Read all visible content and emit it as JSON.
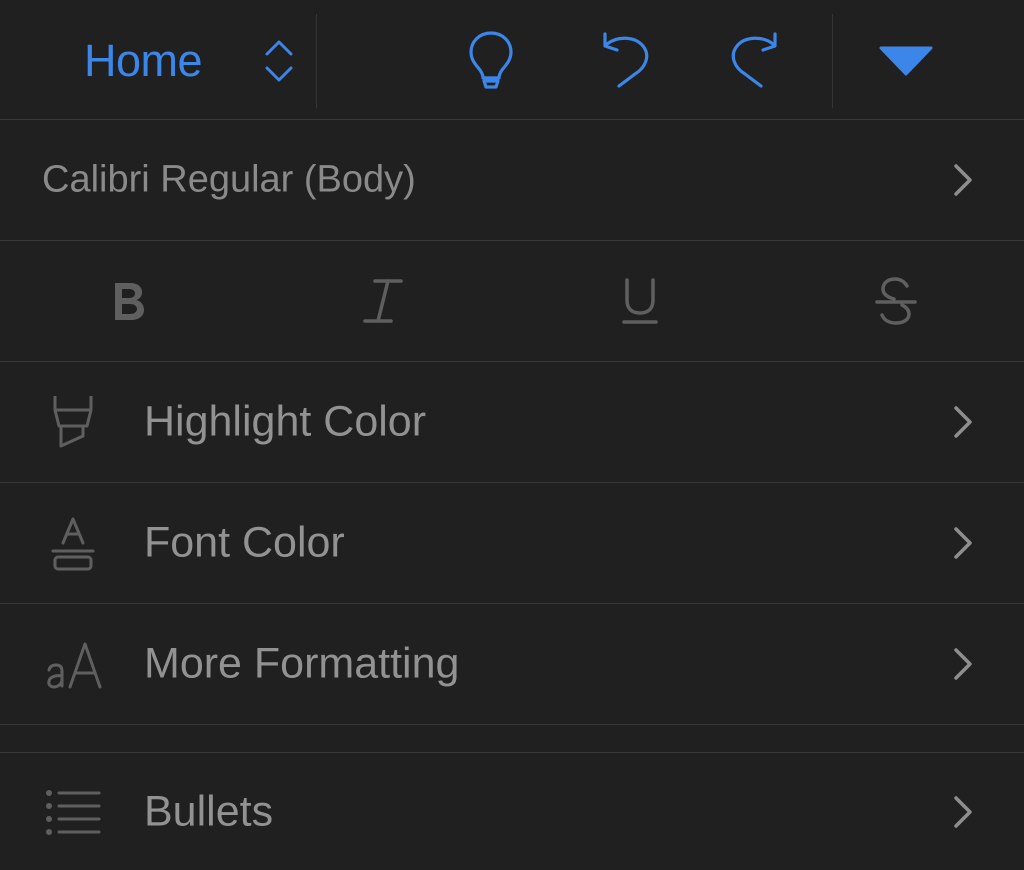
{
  "toolbar": {
    "tab_title": "Home",
    "tab_switcher_icon": "chevron-up-down-icon",
    "ideas_icon": "lightbulb-icon",
    "undo_icon": "undo-icon",
    "redo_icon": "redo-icon",
    "collapse_icon": "triangle-down-icon",
    "accent_color": "#3b86e8"
  },
  "font": {
    "name": "Calibri Regular (Body)"
  },
  "text_styles": [
    {
      "name": "bold",
      "icon": "bold-icon"
    },
    {
      "name": "italic",
      "icon": "italic-icon"
    },
    {
      "name": "underline",
      "icon": "underline-icon"
    },
    {
      "name": "strikethrough",
      "icon": "strikethrough-icon"
    }
  ],
  "menu": {
    "items": [
      {
        "label": "Highlight Color",
        "icon": "highlighter-icon"
      },
      {
        "label": "Font Color",
        "icon": "font-color-icon"
      },
      {
        "label": "More Formatting",
        "icon": "text-size-icon"
      },
      {
        "label": "Bullets",
        "icon": "bulleted-list-icon"
      }
    ]
  },
  "colors": {
    "background": "#202020",
    "divider": "#383838",
    "text": "#929292",
    "icon_muted": "#5f5f5f"
  }
}
